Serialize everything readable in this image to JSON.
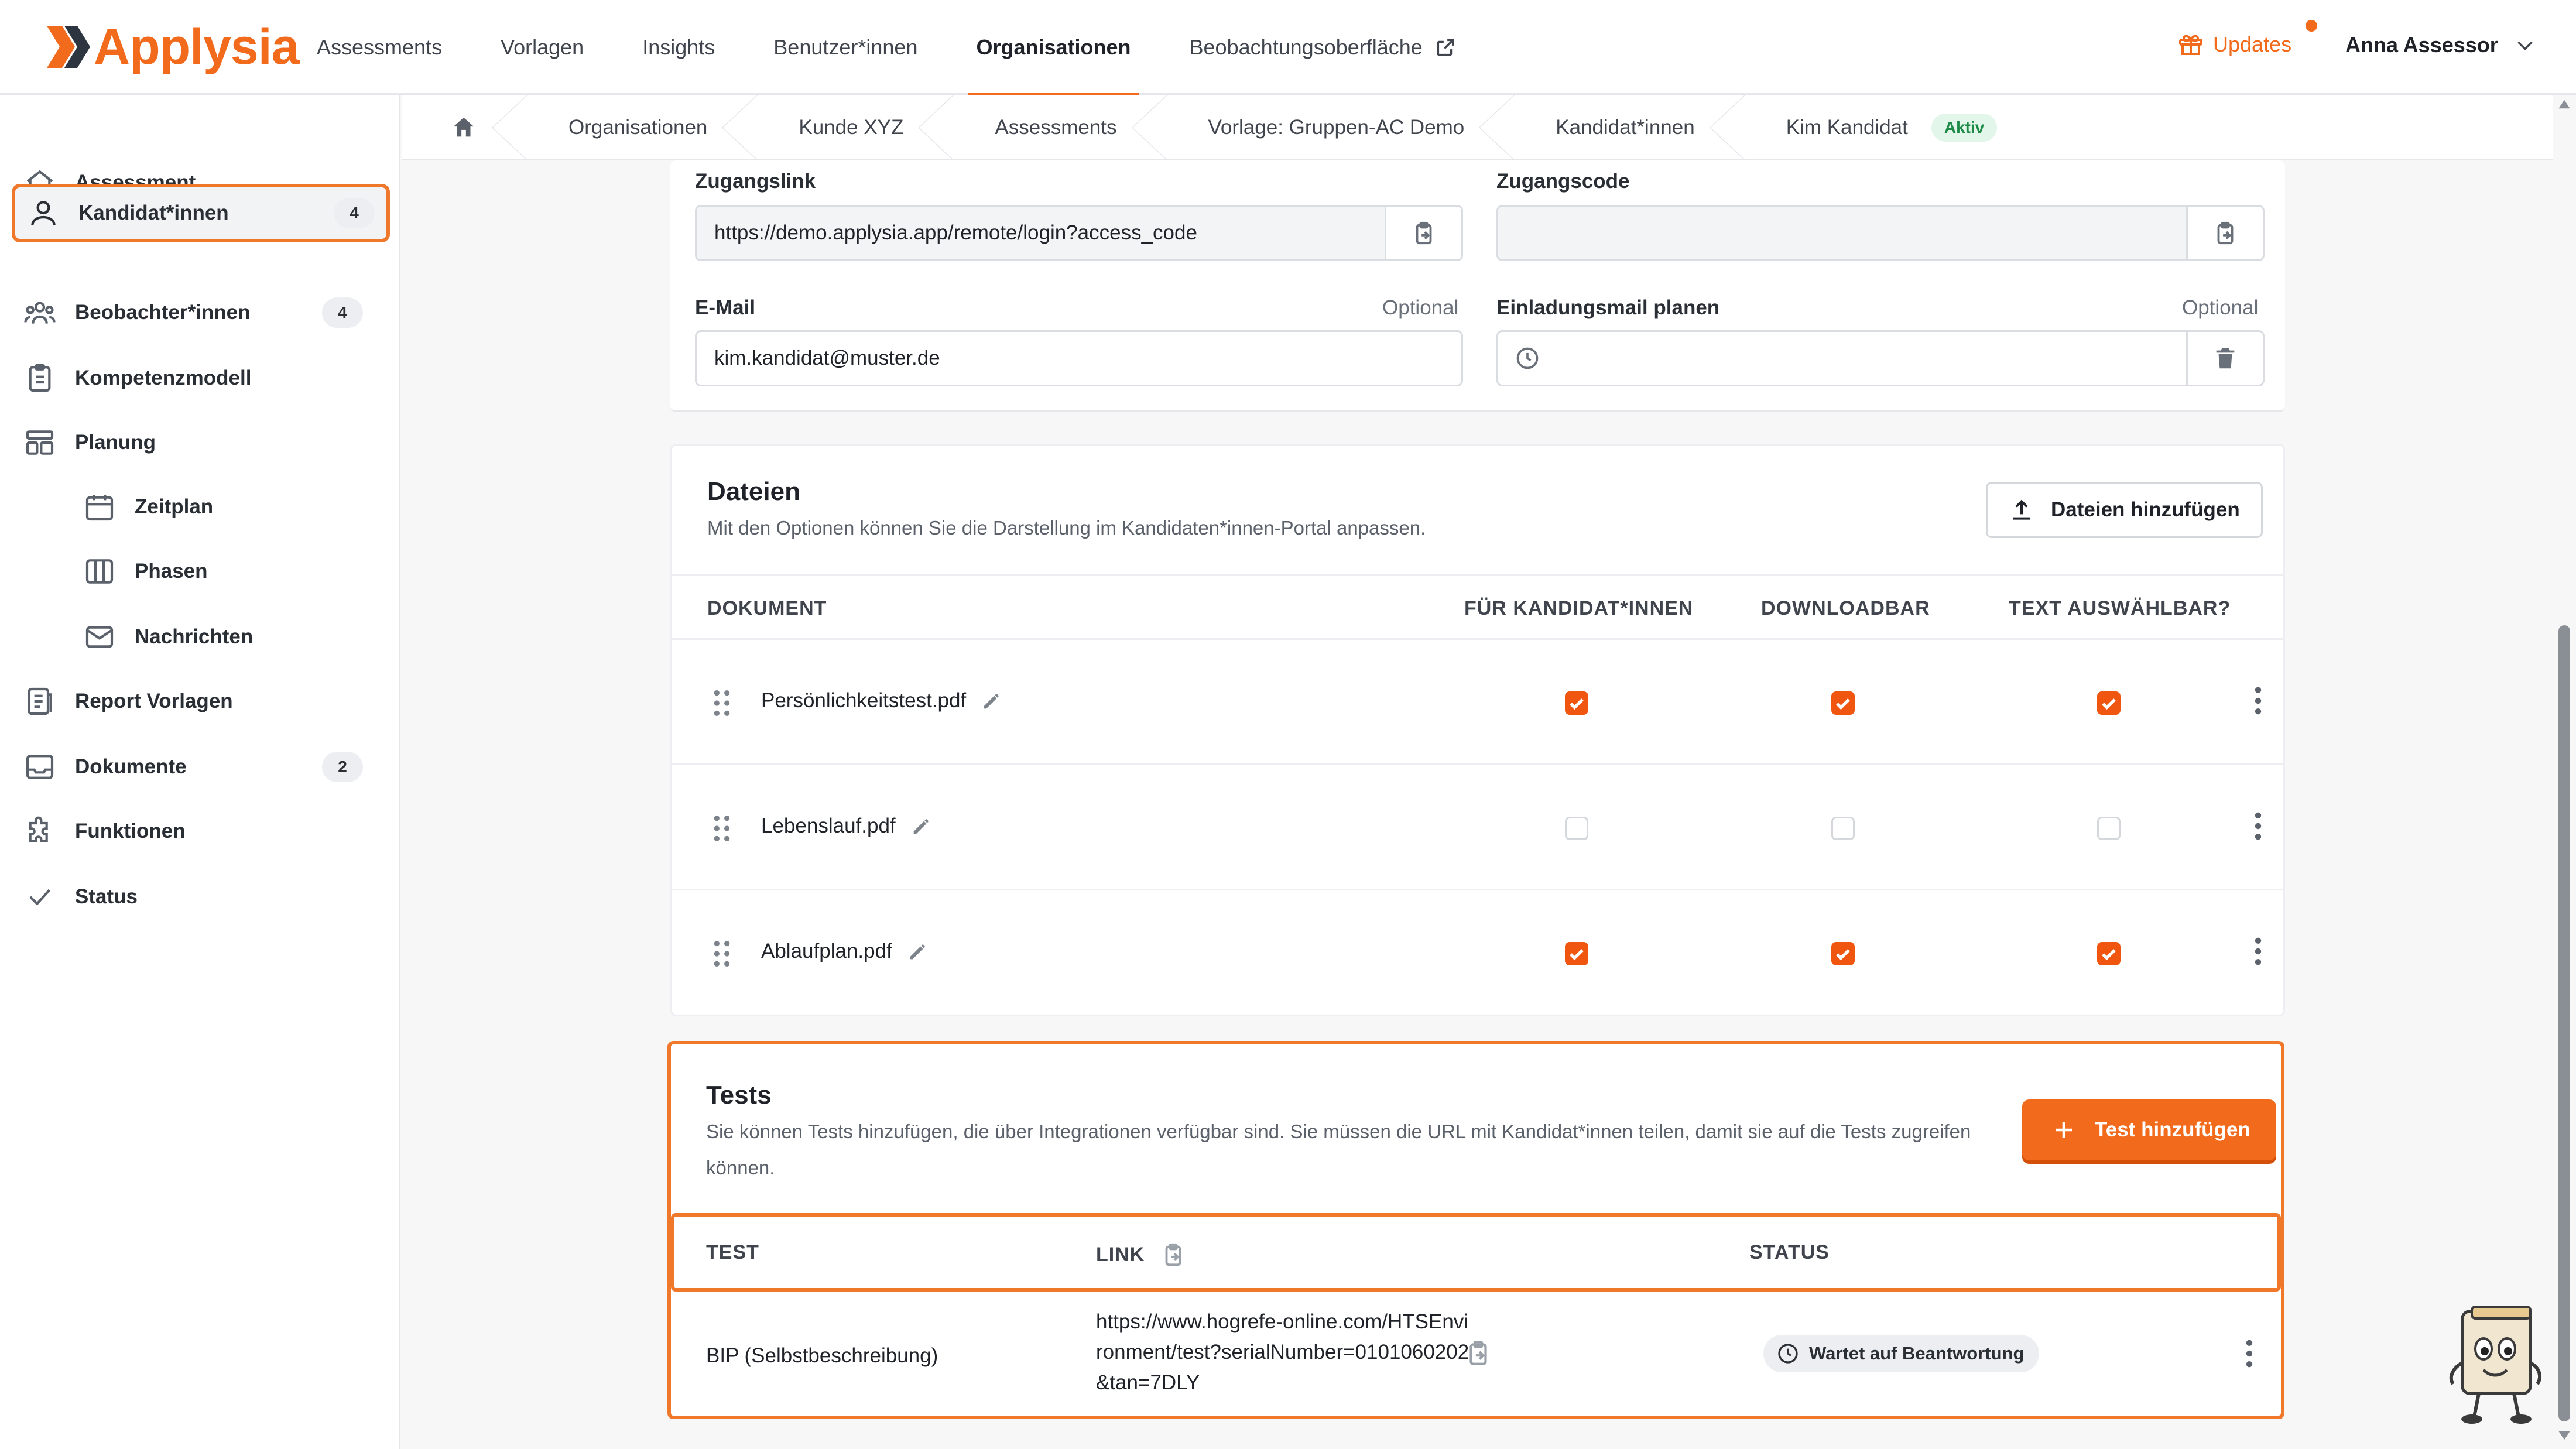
{
  "app": {
    "logo_text": "Applysia",
    "brand_color": "#f26a1b"
  },
  "topnav": {
    "items": [
      "Assessments",
      "Vorlagen",
      "Insights",
      "Benutzer*innen",
      "Organisationen",
      "Beobachtungsoberfläche"
    ],
    "active": "Organisationen",
    "updates_label": "Updates",
    "user_name": "Anna Assessor"
  },
  "sidebar": {
    "items": [
      {
        "label": "Assessment",
        "icon": "home-icon"
      },
      {
        "label": "Kandidat*innen",
        "icon": "users-icon",
        "badge": "4",
        "active": true
      },
      {
        "label": "Beobachter*innen",
        "icon": "group-icon",
        "badge": "4"
      },
      {
        "label": "Kompetenzmodell",
        "icon": "clipboard-icon"
      },
      {
        "label": "Planung",
        "icon": "layout-icon"
      },
      {
        "label": "Zeitplan",
        "icon": "calendar-icon"
      },
      {
        "label": "Phasen",
        "icon": "columns-icon"
      },
      {
        "label": "Nachrichten",
        "icon": "mail-icon"
      },
      {
        "label": "Report Vorlagen",
        "icon": "report-icon"
      },
      {
        "label": "Dokumente",
        "icon": "inbox-icon",
        "badge": "2"
      },
      {
        "label": "Funktionen",
        "icon": "puzzle-icon"
      },
      {
        "label": "Status",
        "icon": "check-icon"
      }
    ]
  },
  "breadcrumb": {
    "items": [
      "Organisationen",
      "Kunde XYZ",
      "Assessments",
      "Vorlage: Gruppen-AC Demo",
      "Kandidat*innen",
      "Kim Kandidat"
    ],
    "status_badge": "Aktiv"
  },
  "access": {
    "link_label": "Zugangslink",
    "link_value": "https://demo.applysia.app/remote/login?access_code",
    "code_label": "Zugangscode",
    "code_value": "",
    "email_label": "E-Mail",
    "email_optional": "Optional",
    "email_value": "kim.kandidat@muster.de",
    "invite_label": "Einladungsmail planen",
    "invite_optional": "Optional",
    "invite_value": ""
  },
  "files": {
    "title": "Dateien",
    "description": "Mit den Optionen können Sie die Darstellung im Kandidaten*innen-Portal anpassen.",
    "add_button": "Dateien hinzufügen",
    "columns": [
      "DOKUMENT",
      "FÜR KANDIDAT*INNEN",
      "DOWNLOADBAR",
      "TEXT AUSWÄHLBAR?"
    ],
    "rows": [
      {
        "name": "Persönlichkeitstest.pdf",
        "for_candidates": true,
        "downloadable": true,
        "selectable": true
      },
      {
        "name": "Lebenslauf.pdf",
        "for_candidates": false,
        "downloadable": false,
        "selectable": false
      },
      {
        "name": "Ablaufplan.pdf",
        "for_candidates": true,
        "downloadable": true,
        "selectable": true
      }
    ]
  },
  "tests": {
    "title": "Tests",
    "description": "Sie können Tests hinzufügen, die über Integrationen verfügbar sind. Sie müssen die URL mit Kandidat*innen teilen, damit sie auf die Tests zugreifen können.",
    "add_button": "Test hinzufügen",
    "columns": [
      "TEST",
      "LINK",
      "STATUS"
    ],
    "rows": [
      {
        "name": "BIP (Selbstbeschreibung)",
        "link": "https://www.hogrefe-online.com/HTSEnvironment/test?serialNumber=0101060202&tan=7DLY",
        "status": "Wartet auf Beantwortung"
      }
    ]
  }
}
